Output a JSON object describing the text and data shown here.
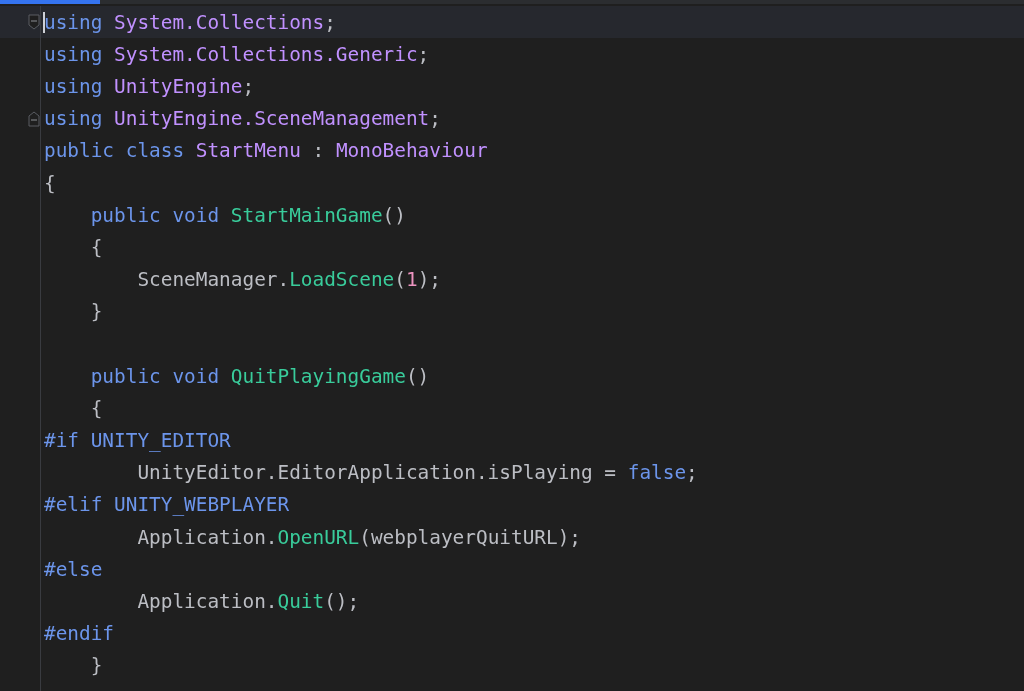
{
  "editor": {
    "lines": [
      {
        "current": true,
        "fold_start": true,
        "tokens": [
          {
            "kind": "keyword",
            "text": "using"
          },
          {
            "kind": "type",
            "text": " System.Collections"
          },
          {
            "kind": "plain",
            "text": ";"
          }
        ]
      },
      {
        "current": false,
        "tokens": [
          {
            "kind": "keyword",
            "text": "using"
          },
          {
            "kind": "type",
            "text": " System.Collections.Generic"
          },
          {
            "kind": "plain",
            "text": ";"
          }
        ]
      },
      {
        "current": false,
        "tokens": [
          {
            "kind": "keyword",
            "text": "using"
          },
          {
            "kind": "type",
            "text": " UnityEngine"
          },
          {
            "kind": "plain",
            "text": ";"
          }
        ]
      },
      {
        "current": false,
        "fold_end": true,
        "tokens": [
          {
            "kind": "keyword",
            "text": "using"
          },
          {
            "kind": "type",
            "text": " UnityEngine.SceneManagement"
          },
          {
            "kind": "plain",
            "text": ";"
          }
        ]
      },
      {
        "current": false,
        "tokens": [
          {
            "kind": "keyword",
            "text": "public class"
          },
          {
            "kind": "type",
            "text": " StartMenu"
          },
          {
            "kind": "plain",
            "text": " : "
          },
          {
            "kind": "type",
            "text": "MonoBehaviour"
          }
        ]
      },
      {
        "current": false,
        "tokens": [
          {
            "kind": "plain",
            "text": "{"
          }
        ]
      },
      {
        "current": false,
        "tokens": [
          {
            "kind": "keyword",
            "text": "    public void"
          },
          {
            "kind": "method",
            "text": " StartMainGame"
          },
          {
            "kind": "plain",
            "text": "()"
          }
        ]
      },
      {
        "current": false,
        "tokens": [
          {
            "kind": "plain",
            "text": "    {"
          }
        ]
      },
      {
        "current": false,
        "tokens": [
          {
            "kind": "plain",
            "text": "        SceneManager."
          },
          {
            "kind": "method",
            "text": "LoadScene"
          },
          {
            "kind": "plain",
            "text": "("
          },
          {
            "kind": "number",
            "text": "1"
          },
          {
            "kind": "plain",
            "text": ");"
          }
        ]
      },
      {
        "current": false,
        "tokens": [
          {
            "kind": "plain",
            "text": "    }"
          }
        ]
      },
      {
        "current": false
      },
      {
        "current": false,
        "tokens": [
          {
            "kind": "keyword",
            "text": "    public void"
          },
          {
            "kind": "method",
            "text": " QuitPlayingGame"
          },
          {
            "kind": "plain",
            "text": "()"
          }
        ]
      },
      {
        "current": false,
        "tokens": [
          {
            "kind": "plain",
            "text": "    {"
          }
        ]
      },
      {
        "current": false,
        "tokens": [
          {
            "kind": "keyword",
            "text": "#if UNITY_EDITOR"
          }
        ]
      },
      {
        "current": false,
        "tokens": [
          {
            "kind": "plain",
            "text": "        UnityEditor.EditorApplication.isPlaying = "
          },
          {
            "kind": "keyword",
            "text": "false"
          },
          {
            "kind": "plain",
            "text": ";"
          }
        ]
      },
      {
        "current": false,
        "tokens": [
          {
            "kind": "keyword",
            "text": "#elif UNITY_WEBPLAYER"
          }
        ]
      },
      {
        "current": false,
        "tokens": [
          {
            "kind": "plain",
            "text": "        Application."
          },
          {
            "kind": "method",
            "text": "OpenURL"
          },
          {
            "kind": "plain",
            "text": "(webplayerQuitURL);"
          }
        ]
      },
      {
        "current": false,
        "tokens": [
          {
            "kind": "keyword",
            "text": "#else"
          }
        ]
      },
      {
        "current": false,
        "tokens": [
          {
            "kind": "plain",
            "text": "        Application."
          },
          {
            "kind": "method",
            "text": "Quit"
          },
          {
            "kind": "plain",
            "text": "();"
          }
        ]
      },
      {
        "current": false,
        "tokens": [
          {
            "kind": "keyword",
            "text": "#endif"
          }
        ]
      },
      {
        "current": false,
        "tokens": [
          {
            "kind": "plain",
            "text": "    }"
          }
        ]
      }
    ]
  }
}
